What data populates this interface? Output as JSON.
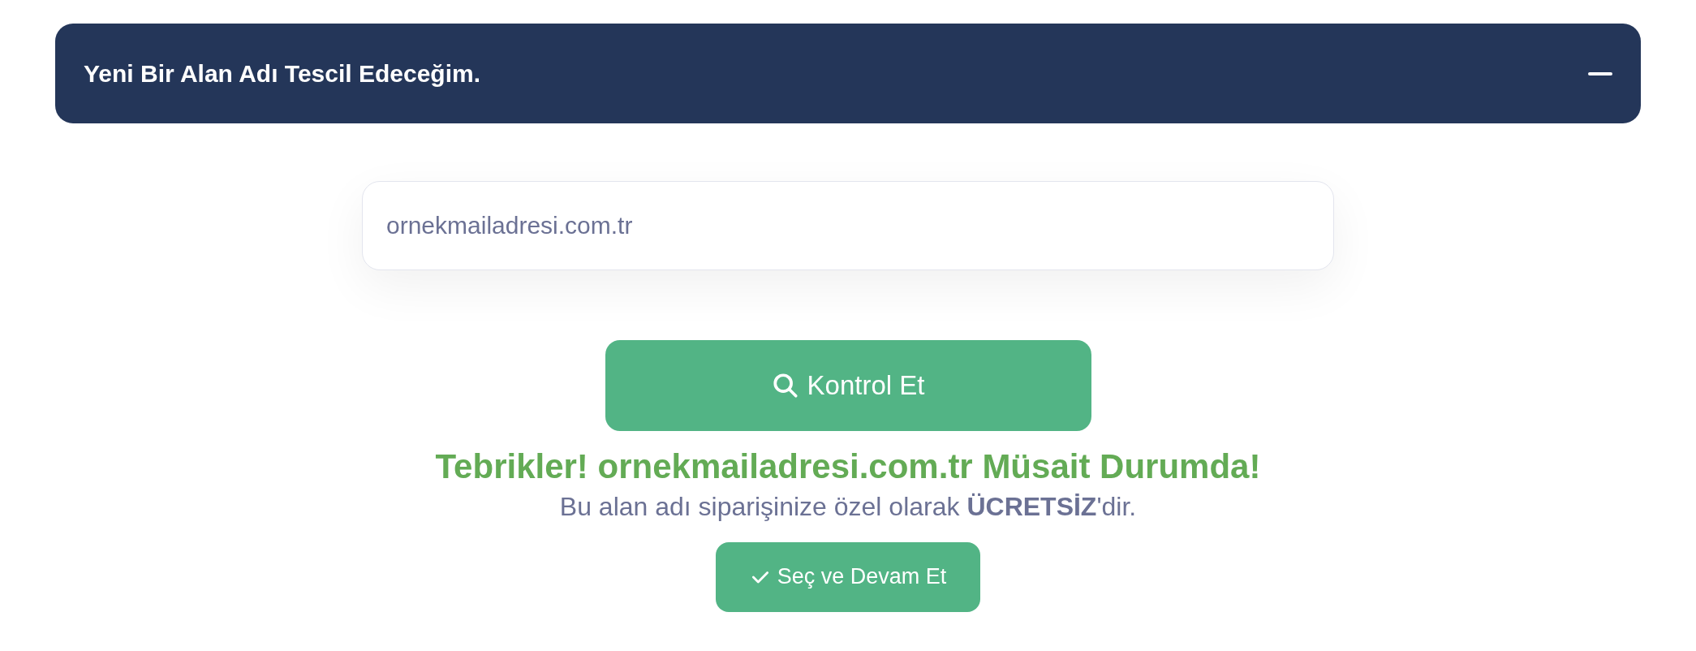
{
  "accordion": {
    "title": "Yeni Bir Alan Adı Tescil Edeceğim.",
    "expanded": true
  },
  "domain_field": {
    "value": "ornekmailadresi.com.tr"
  },
  "search_button": {
    "label": "Kontrol Et"
  },
  "result": {
    "title": "Tebrikler! ornekmailadresi.com.tr Müsait Durumda!",
    "note": "Bu alan adı siparişinize özel olarak **ÜCRETSİZ**'dir."
  },
  "select_button": {
    "label": "Seç ve Devam Et"
  }
}
